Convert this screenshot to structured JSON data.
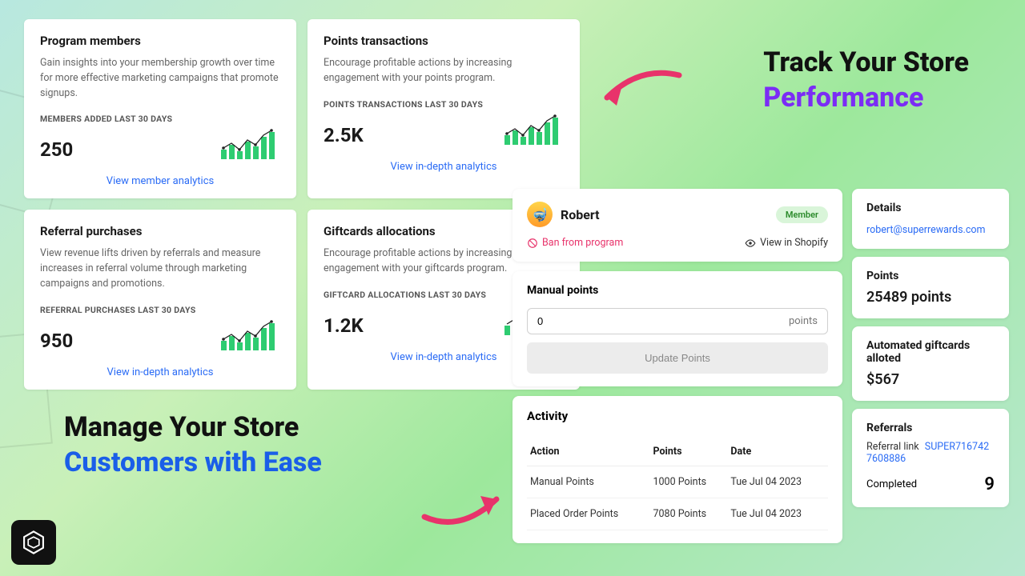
{
  "headlines": {
    "top_l1": "Track Your Store",
    "top_l2": "Performance",
    "bottom_l1": "Manage Your  Store",
    "bottom_l2": "Customers with Ease"
  },
  "cards": {
    "members": {
      "title": "Program members",
      "desc": "Gain insights into your membership growth over time for more effective marketing campaigns that promote signups.",
      "metric_label": "MEMBERS ADDED LAST 30 DAYS",
      "metric": "250",
      "link": "View member analytics"
    },
    "points": {
      "title": "Points transactions",
      "desc": "Encourage profitable actions by increasing engagement with your points program.",
      "metric_label": "POINTS TRANSACTIONS LAST 30 DAYS",
      "metric": "2.5K",
      "link": "View in-depth analytics"
    },
    "referral": {
      "title": "Referral purchases",
      "desc": "View revenue lifts driven by referrals and measure increases in referral volume through marketing campaigns and promotions.",
      "metric_label": "REFERRAL PURCHASES LAST 30 DAYS",
      "metric": "950",
      "link": "View in-depth analytics"
    },
    "giftcards": {
      "title": "Giftcards allocations",
      "desc": "Encourage profitable actions by increasing engagement with your giftcards program.",
      "metric_label": "GIFTCARD ALLOCATIONS LAST 30 DAYS",
      "metric": "1.2K",
      "link": "View in-depth analytics"
    }
  },
  "customer": {
    "name": "Robert",
    "badge": "Member",
    "ban_label": "Ban from program",
    "view_shopify": "View in Shopify",
    "manual_points_title": "Manual points",
    "manual_points_value": "0",
    "manual_points_unit": "points",
    "update_btn": "Update Points",
    "activity_title": "Activity",
    "activity_headers": {
      "action": "Action",
      "points": "Points",
      "date": "Date"
    },
    "activity_rows": [
      {
        "action": "Manual Points",
        "points": "1000 Points",
        "date": "Tue Jul 04 2023"
      },
      {
        "action": "Placed Order Points",
        "points": "7080 Points",
        "date": "Tue Jul 04 2023"
      }
    ],
    "details": {
      "title": "Details",
      "email": "robert@superrewards.com"
    },
    "points_panel": {
      "title": "Points",
      "value": "25489 points"
    },
    "gift_panel": {
      "title": "Automated giftcards alloted",
      "value": "$567"
    },
    "referrals_panel": {
      "title": "Referrals",
      "link_label": "Referral link",
      "code": "SUPER7167427608886",
      "completed_label": "Completed",
      "completed": "9"
    }
  }
}
